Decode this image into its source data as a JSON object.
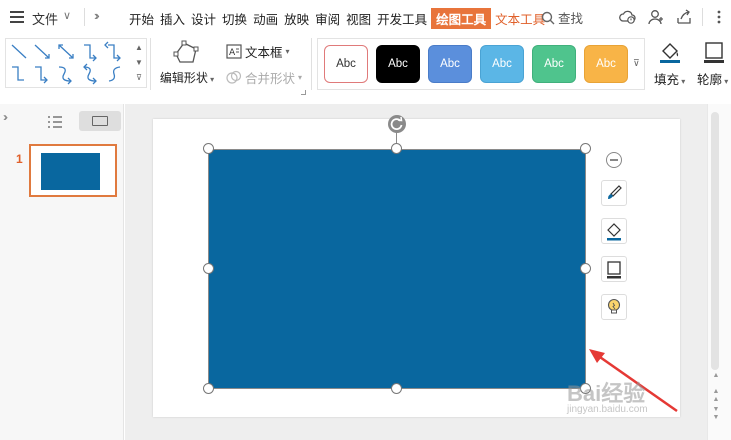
{
  "menubar": {
    "file_label": "文件",
    "tabs": [
      {
        "label": "开始"
      },
      {
        "label": "插入"
      },
      {
        "label": "设计"
      },
      {
        "label": "切换"
      },
      {
        "label": "动画"
      },
      {
        "label": "放映"
      },
      {
        "label": "审阅"
      },
      {
        "label": "视图"
      },
      {
        "label": "开发工具"
      },
      {
        "label": "绘图工具",
        "active": true
      },
      {
        "label": "文本工具",
        "contextual": true
      }
    ],
    "search_label": "查找",
    "icons": [
      "cloud-sync-icon",
      "user-icon",
      "share-icon",
      "more-icon"
    ]
  },
  "ribbon": {
    "edit_shape_label": "编辑形状",
    "textbox_label": "文本框",
    "merge_shapes_label": "合并形状",
    "fill_label": "填充",
    "outline_label": "轮廓",
    "shape_styles": [
      {
        "label": "Abc",
        "bg": "#ffffff",
        "fg": "#333333",
        "border": "#e07a7a"
      },
      {
        "label": "Abc",
        "bg": "#000000",
        "fg": "#ffffff",
        "border": "#000000"
      },
      {
        "label": "Abc",
        "bg": "#5b8fdc",
        "fg": "#ffffff",
        "border": "#4a7cc8"
      },
      {
        "label": "Abc",
        "bg": "#5bb6e6",
        "fg": "#ffffff",
        "border": "#4aa3d4"
      },
      {
        "label": "Abc",
        "bg": "#4fc48d",
        "fg": "#ffffff",
        "border": "#40b07c"
      },
      {
        "label": "Abc",
        "bg": "#f8b447",
        "fg": "#ffffff",
        "border": "#e8a336"
      }
    ]
  },
  "slides_panel": {
    "slide_number": "1"
  },
  "canvas": {
    "shape_fill": "#09679f",
    "floating_tools": [
      "collapse-icon",
      "brush-icon",
      "fill-icon",
      "outline-icon",
      "bulb-icon"
    ]
  },
  "watermark": {
    "text": "Bai经验",
    "sub": "jingyan.baidu.com"
  },
  "colors": {
    "accent": "#e8743b",
    "contextual_tab": "#e0602a",
    "annotation_arrow": "#e53935"
  }
}
